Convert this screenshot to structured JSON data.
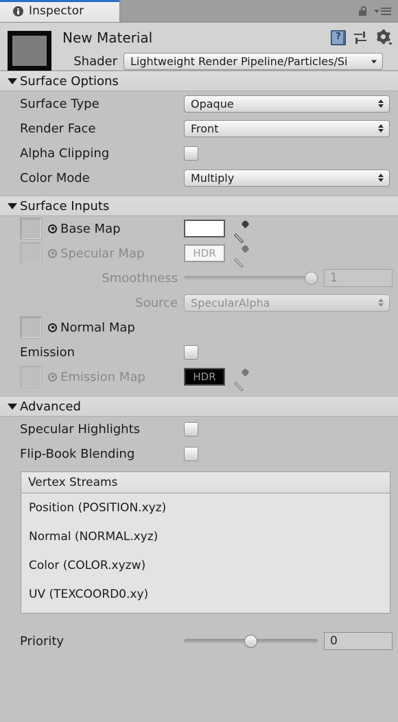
{
  "window": {
    "tab_label": "Inspector",
    "info_icon": "info-icon",
    "lock_icon": "lock-icon",
    "menu_icon": "hamburger-menu-icon",
    "accent_color": "#2b6fc4"
  },
  "material": {
    "name": "New Material",
    "preview_color": "#7d7d7d",
    "shader_label": "Shader",
    "shader_value": "Lightweight Render Pipeline/Particles/Si",
    "help_icon": "help-book-icon",
    "help_glyph": "?",
    "preset_icon": "preset-sliders-icon",
    "settings_icon": "gear-icon"
  },
  "sections": {
    "surface_options": {
      "title": "Surface Options",
      "expanded": true,
      "rows": [
        {
          "label": "Surface Type",
          "type": "dropdown",
          "value": "Opaque",
          "enabled": true
        },
        {
          "label": "Render Face",
          "type": "dropdown",
          "value": "Front",
          "enabled": true
        },
        {
          "label": "Alpha Clipping",
          "type": "checkbox",
          "value": false,
          "enabled": true
        },
        {
          "label": "Color Mode",
          "type": "dropdown",
          "value": "Multiply",
          "enabled": true
        }
      ]
    },
    "surface_inputs": {
      "title": "Surface Inputs",
      "expanded": true,
      "rows": [
        {
          "label": "Base Map",
          "type": "texture-color",
          "color": "#ffffff",
          "hdr": false,
          "enabled": true
        },
        {
          "label": "Specular Map",
          "type": "texture-color",
          "color": "#f6f6f6",
          "hdr": true,
          "hdr_text": "HDR",
          "enabled": false
        },
        {
          "label": "Smoothness",
          "type": "slider",
          "value": "1",
          "fraction": 1.0,
          "enabled": false
        },
        {
          "label": "Source",
          "type": "dropdown",
          "value": "SpecularAlpha",
          "enabled": false
        },
        {
          "label": "Normal Map",
          "type": "texture",
          "enabled": true
        },
        {
          "label": "Emission",
          "type": "checkbox",
          "value": false,
          "enabled": true
        },
        {
          "label": "Emission Map",
          "type": "texture-color",
          "color": "#000000",
          "hdr": true,
          "hdr_text": "HDR",
          "enabled": false
        }
      ]
    },
    "advanced": {
      "title": "Advanced",
      "expanded": true,
      "rows": [
        {
          "label": "Specular Highlights",
          "type": "checkbox",
          "value": false,
          "enabled": true
        },
        {
          "label": "Flip-Book Blending",
          "type": "checkbox",
          "value": false,
          "enabled": true
        }
      ]
    }
  },
  "vertex_streams": {
    "header": "Vertex Streams",
    "items": [
      "Position (POSITION.xyz)",
      "Normal (NORMAL.xyz)",
      "Color (COLOR.xyzw)",
      "UV (TEXCOORD0.xy)"
    ]
  },
  "priority": {
    "label": "Priority",
    "value": "0",
    "fraction": 0.5
  }
}
